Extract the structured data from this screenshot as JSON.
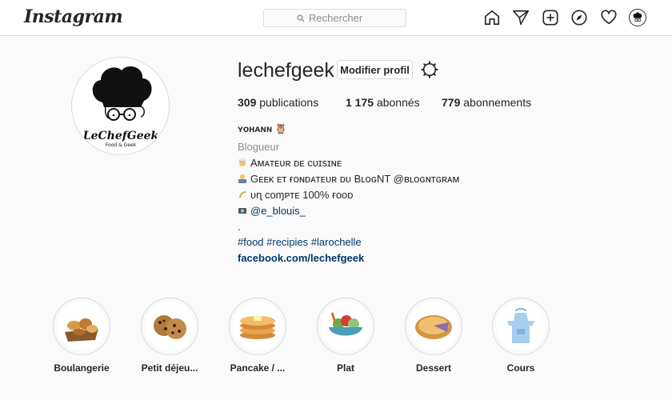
{
  "nav": {
    "logo": "Instagram",
    "search_placeholder": "Rechercher",
    "icons": [
      "home-icon",
      "direct-send-icon",
      "new-post-icon",
      "explore-compass-icon",
      "activity-heart-icon",
      "profile-avatar-icon"
    ]
  },
  "profile": {
    "username": "lechefgeek",
    "edit_label": "Modifier profil",
    "avatar_brand": "LeChefGeek",
    "avatar_sub": "Food & Geek",
    "stats": {
      "posts_count": "309",
      "posts_label": "publications",
      "followers_count": "1 175",
      "followers_label": "abonnés",
      "following_count": "779",
      "following_label": "abonnements"
    },
    "bio": {
      "name": "ʏᴏʜᴀɴɴ 🦉",
      "category": "Blogueur",
      "line1": "Aᴍᴀᴛᴇᴜʀ ᴅᴇ ᴄᴜɪsɪɴᴇ",
      "line2": "Gᴇᴇᴋ ᴇᴛ ғᴏɴᴅᴀᴛᴇᴜʀ ᴅᴜ BʟᴏɢNT @ʙʟᴏɢɴᴛɢʀᴀᴍ",
      "line3": "ᴜɳ ᴄᴏɱᴘᴛᴇ 100% ғᴏᴏᴅ",
      "line4_handle": "@e_blouis_",
      "dot": ".",
      "hashtags": "#food #recipies #larochelle",
      "website": "facebook.com/lechefgeek"
    }
  },
  "highlights": [
    {
      "label": "Boulangerie",
      "icon": "bread-basket-icon"
    },
    {
      "label": "Petit déjeu...",
      "icon": "cookies-icon"
    },
    {
      "label": "Pancake / ...",
      "icon": "pancakes-icon"
    },
    {
      "label": "Plat",
      "icon": "salad-bowl-icon"
    },
    {
      "label": "Dessert",
      "icon": "pie-icon"
    },
    {
      "label": "Cours",
      "icon": "apron-icon"
    }
  ]
}
